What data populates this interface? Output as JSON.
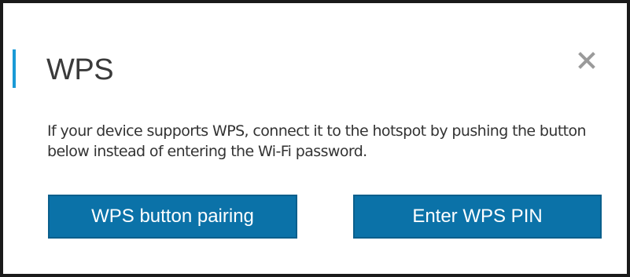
{
  "dialog": {
    "title": "WPS",
    "close_icon": "close-icon",
    "description": "If your device supports WPS, connect it to the hotspot by pushing the button below instead of entering the Wi-Fi password.",
    "buttons": {
      "wps_pairing_label": "WPS button pairing",
      "enter_pin_label": "Enter WPS PIN"
    }
  },
  "colors": {
    "accent": "#1a9ad6",
    "button_bg": "#0b72a8",
    "border": "#1a1a1a",
    "close_icon": "#9a9a9a"
  }
}
